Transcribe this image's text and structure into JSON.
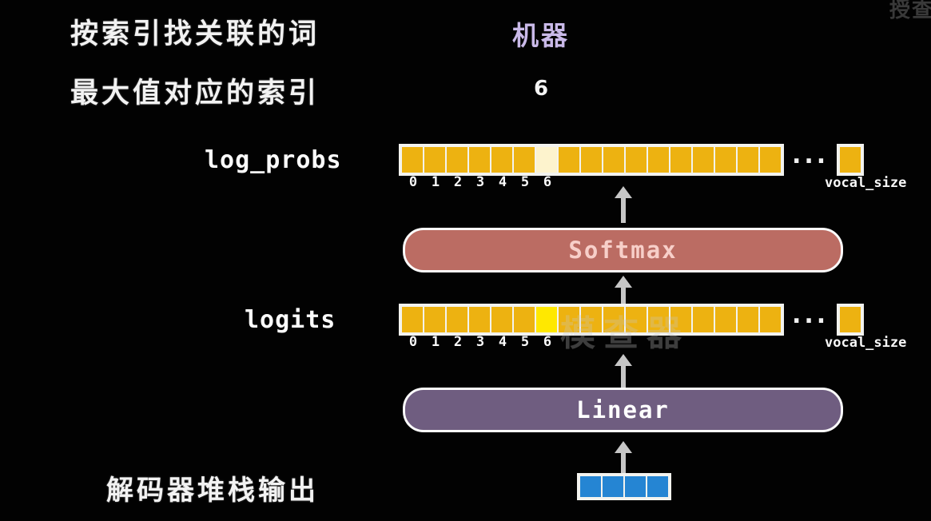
{
  "annotations": {
    "lookup_word_by_index_label": "按索引找关联的词",
    "argmax_index_label": "最大值对应的索引",
    "decoder_stack_output_label": "解码器堆栈输出",
    "predicted_word": "机器",
    "predicted_index": "6"
  },
  "rows": {
    "log_probs": {
      "label": "log_probs",
      "vocab_caption": "vocal_size",
      "ellipsis": "...",
      "index_ticks": [
        "0",
        "1",
        "2",
        "3",
        "4",
        "5",
        "6"
      ],
      "cell_count": 17,
      "highlight_index": 6,
      "highlight_style": "pale",
      "tail_cell_count": 1
    },
    "logits": {
      "label": "logits",
      "vocab_caption": "vocal_size",
      "ellipsis": "...",
      "index_ticks": [
        "0",
        "1",
        "2",
        "3",
        "4",
        "5",
        "6"
      ],
      "cell_count": 17,
      "highlight_index": 6,
      "highlight_style": "bright",
      "tail_cell_count": 1
    },
    "decoder_output": {
      "cell_count": 4
    }
  },
  "blocks": {
    "softmax_label": "Softmax",
    "linear_label": "Linear"
  },
  "watermarks": {
    "center": "模查器",
    "corner": "授查"
  },
  "colors": {
    "background": "#020202",
    "cell_default": "#edb211",
    "cell_pale": "#fdf3cd",
    "cell_bright": "#ffe800",
    "cell_blue": "#2585d3",
    "softmax_fill": "#bb6c63",
    "softmax_text": "#f7cfc9",
    "linear_fill": "#6f5d80",
    "linear_text": "#ffffff",
    "predicted_word": "#c9b9e8",
    "arrow": "#c6c6c6",
    "border": "#f3f3ef"
  }
}
